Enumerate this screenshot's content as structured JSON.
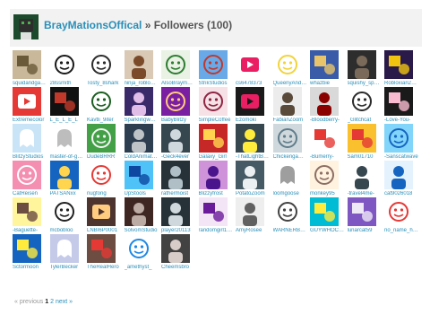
{
  "header": {
    "username": "BrayMationsOffical",
    "separator": " » ",
    "page_title": "Followers (100)"
  },
  "followers": [
    {
      "name": "squidandgames",
      "bg": "#c9b99a",
      "fg": "#6b5a3a",
      "shape": "art"
    },
    {
      "name": "28ssmith",
      "bg": "#ffffff",
      "fg": "#1a1a1a",
      "shape": "face"
    },
    {
      "name": "Tosty_8shark",
      "bg": "#ffffff",
      "fg": "#2b2b2b",
      "shape": "face"
    },
    {
      "name": "ninja_robloxplay",
      "bg": "#d9c9b5",
      "fg": "#7a4a2a",
      "shape": "person"
    },
    {
      "name": "AlsoBraymation",
      "bg": "#e9f2e4",
      "fg": "#2e7d32",
      "shape": "face"
    },
    {
      "name": "StrikStudios",
      "bg": "#6aa9e8",
      "fg": "#c0392b",
      "shape": "face"
    },
    {
      "name": "cs6478373",
      "bg": "#ffffff",
      "fg": "#e91e63",
      "shape": "logo"
    },
    {
      "name": "QueenyAndCo",
      "bg": "#ffffff",
      "fg": "#f2d43a",
      "shape": "face"
    },
    {
      "name": "whazbie",
      "bg": "#3a5ca8",
      "fg": "#e9c46a",
      "shape": "art"
    },
    {
      "name": "squishy_sprite",
      "bg": "#2d2d2d",
      "fg": "#7a6a5a",
      "shape": "person"
    },
    {
      "name": "Robloxian2009",
      "bg": "#2a1a4a",
      "fg": "#f1c40f",
      "shape": "art"
    },
    {
      "name": "Extremecolor",
      "bg": "#e53935",
      "fg": "#ffffff",
      "shape": "logo"
    },
    {
      "name": "L_E_L_E_L",
      "bg": "#111111",
      "fg": "#c0392b",
      "shape": "art"
    },
    {
      "name": "Kavtli_9iter",
      "bg": "#ffffff",
      "fg": "#1b5e20",
      "shape": "face"
    },
    {
      "name": "Sparklingwater",
      "bg": "#3b2a6a",
      "fg": "#e1bee7",
      "shape": "person"
    },
    {
      "name": "BabyBlitzy",
      "bg": "#7b1fa2",
      "fg": "#ffcc80",
      "shape": "face"
    },
    {
      "name": "SimpleCoffee",
      "bg": "#f5e1e6",
      "fg": "#8e2442",
      "shape": "face"
    },
    {
      "name": "Ezomoki",
      "bg": "#1a1a1a",
      "fg": "#e91e63",
      "shape": "logo"
    },
    {
      "name": "FabianZoom",
      "bg": "#ececec",
      "fg": "#5a4a3a",
      "shape": "person"
    },
    {
      "name": "-Bloodberry-",
      "bg": "#d9d9d9",
      "fg": "#8b0000",
      "shape": "person"
    },
    {
      "name": "_Glitchcat",
      "bg": "#ffffff",
      "fg": "#2b2b2b",
      "shape": "face"
    },
    {
      "name": "-Love-You-",
      "bg": "#1a1a1a",
      "fg": "#f8bbd0",
      "shape": "art"
    },
    {
      "name": "BlitzyStudios",
      "bg": "#c9e4f7",
      "fg": "#ffffff",
      "shape": "ghost"
    },
    {
      "name": "master-of-games",
      "bg": "#ffffff",
      "fg": "#bdbdbd",
      "shape": "ghost"
    },
    {
      "name": "DudeBRRR",
      "bg": "#43a047",
      "fg": "#f5f5f5",
      "shape": "face"
    },
    {
      "name": "ColdAnimation",
      "bg": "#2c3e50",
      "fg": "#bdc3c7",
      "shape": "person"
    },
    {
      "name": "-Geck4ever",
      "bg": "#37474f",
      "fg": "#cfd8dc",
      "shape": "person"
    },
    {
      "name": "Galaxy_Girl",
      "bg": "#c62828",
      "fg": "#ffd54f",
      "shape": "art"
    },
    {
      "name": "-ThatLightBulb",
      "bg": "#37474f",
      "fg": "#ffeb3b",
      "shape": "person"
    },
    {
      "name": "Chickengamer",
      "bg": "#cfd8dc",
      "fg": "#607d8b",
      "shape": "face"
    },
    {
      "name": "-Bumerry-",
      "bg": "#ffffff",
      "fg": "#e53935",
      "shape": "art"
    },
    {
      "name": "Sam01710",
      "bg": "#fbc02d",
      "fg": "#e53935",
      "shape": "art"
    },
    {
      "name": "-Sanscatwave",
      "bg": "#81d4fa",
      "fg": "#1565c0",
      "shape": "face"
    },
    {
      "name": "CatReisen",
      "bg": "#f48fb1",
      "fg": "#ffffff",
      "shape": "face"
    },
    {
      "name": "PATSANxx",
      "bg": "#1565c0",
      "fg": "#ffd54f",
      "shape": "person"
    },
    {
      "name": "nugfong",
      "bg": "#ffffff",
      "fg": "#e53935",
      "shape": "face"
    },
    {
      "name": "UpStools",
      "bg": "#4fc3f7",
      "fg": "#0d47a1",
      "shape": "art"
    },
    {
      "name": "rathermoist",
      "bg": "#263238",
      "fg": "#b0bec5",
      "shape": "person"
    },
    {
      "name": "Blizzyfrost",
      "bg": "#ce93d8",
      "fg": "#4a148c",
      "shape": "person"
    },
    {
      "name": "PotatoZoom",
      "bg": "#455a64",
      "fg": "#eceff1",
      "shape": "person"
    },
    {
      "name": "loomgoose",
      "bg": "#ffffff",
      "fg": "#9e9e9e",
      "shape": "ghost"
    },
    {
      "name": "monkey95",
      "bg": "#fff3e0",
      "fg": "#8d6e63",
      "shape": "face"
    },
    {
      "name": "-travel4me-",
      "bg": "#ffffff",
      "fg": "#37474f",
      "shape": "person"
    },
    {
      "name": "cat9026018",
      "bg": "#e3f2fd",
      "fg": "#1565c0",
      "shape": "person"
    },
    {
      "name": "-Baguette-",
      "bg": "#fff59d",
      "fg": "#6d4c41",
      "shape": "art"
    },
    {
      "name": "mcbobloo",
      "bg": "#ffffff",
      "fg": "#212121",
      "shape": "face"
    },
    {
      "name": "LNBI6P0001",
      "bg": "#4e342e",
      "fg": "#ffcc80",
      "shape": "logo"
    },
    {
      "name": "SolvomStudio",
      "bg": "#3e2723",
      "fg": "#bcaaa4",
      "shape": "person"
    },
    {
      "name": "player20113",
      "bg": "#263238",
      "fg": "#cfd8dc",
      "shape": "person"
    },
    {
      "name": "randomgirl123",
      "bg": "#f3e5f5",
      "fg": "#6a1b9a",
      "shape": "art"
    },
    {
      "name": "AmyRosee",
      "bg": "#eeeeee",
      "fg": "#616161",
      "shape": "person"
    },
    {
      "name": "WARNERBROS",
      "bg": "#ffffff",
      "fg": "#424242",
      "shape": "face"
    },
    {
      "name": "GUYWHOCODES",
      "bg": "#00bcd4",
      "fg": "#ffeb3b",
      "shape": "art"
    },
    {
      "name": "lunarcat59",
      "bg": "#7e57c2",
      "fg": "#ede7f6",
      "shape": "art"
    },
    {
      "name": "no_name_here",
      "bg": "#ffffff",
      "fg": "#e53935",
      "shape": "face"
    },
    {
      "name": "Sctormoon",
      "bg": "#1565c0",
      "fg": "#ffeb3b",
      "shape": "art"
    },
    {
      "name": "TylerBecker",
      "bg": "#c5cae9",
      "fg": "#ffffff",
      "shape": "ghost"
    },
    {
      "name": "TheRealHero",
      "bg": "#6d4c41",
      "fg": "#e53935",
      "shape": "art"
    },
    {
      "name": "_amethyst_",
      "bg": "#ffffff",
      "fg": "#1e88e5",
      "shape": "face"
    },
    {
      "name": "Cheemsbro",
      "bg": "#424242",
      "fg": "#d7ccc8",
      "shape": "person"
    }
  ],
  "pager": {
    "prev": "« previous",
    "page1": "1",
    "page2": "2",
    "next": "next »"
  }
}
